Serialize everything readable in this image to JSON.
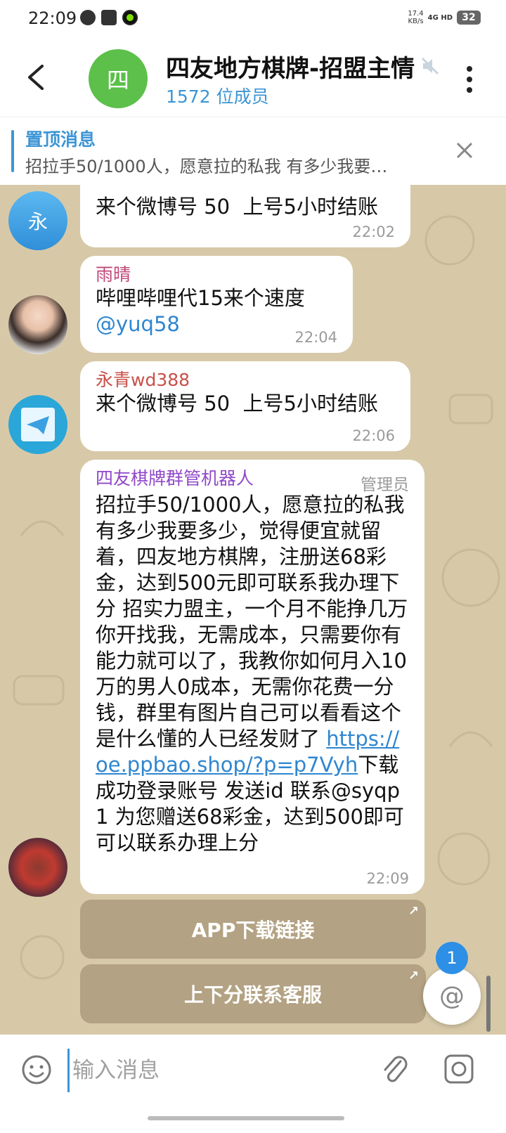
{
  "status": {
    "time": "22:09",
    "net_speed_value": "17.4",
    "net_speed_unit": "KB/s",
    "signal": "4G HD",
    "battery": "32"
  },
  "header": {
    "avatar_letter": "四",
    "title": "四友地方棋牌-招盟主情",
    "members": "1572 位成员",
    "avatar_color": "#5cc04a"
  },
  "pinned": {
    "title": "置顶消息",
    "text": "招拉手50/1000人，愿意拉的私我 有多少我要…"
  },
  "messages": [
    {
      "sender": "",
      "avatar_letter": "永",
      "text": "来个微博号 50  上号5小时结账",
      "time": "22:02"
    },
    {
      "sender": "雨晴",
      "sender_color": "#c04878",
      "text": "哔哩哔哩代15来个速度",
      "mention": "@yuq58",
      "time": "22:04"
    },
    {
      "sender": "永青wd388",
      "sender_color": "#c8504a",
      "text": "来个微博号 50  上号5小时结账",
      "time": "22:06"
    },
    {
      "sender": "四友棋牌群管机器人",
      "sender_color": "#9048c8",
      "badge": "管理员",
      "text_before": "招拉手50/1000人，愿意拉的私我 有多少我要多少，觉得便宜就留着，四友地方棋牌，注册送68彩金，达到500元即可联系我办理下分 招实力盟主，一个月不能挣几万你开找我，无需成本，只需要你有能力就可以了，我教你如何月入10万的男人0成本，无需你花费一分钱，群里有图片自己可以看看这个是什么懂的人已经发财了 ",
      "link": "https://oe.ppbao.shop/?p=p7Vyh",
      "text_after": "下载成功登录账号 发送id 联系@syqp1 为您赠送68彩金，达到500即可可以联系办理上分",
      "time": "22:09"
    }
  ],
  "buttons": [
    {
      "label": "APP下载链接"
    },
    {
      "label": "上下分联系客服"
    }
  ],
  "unread_count": "1",
  "input": {
    "placeholder": "输入消息"
  }
}
